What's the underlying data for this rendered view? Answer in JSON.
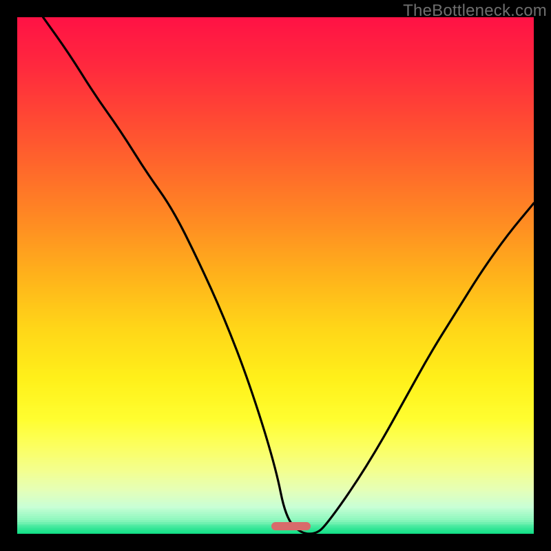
{
  "watermark": "TheBottleneck.com",
  "colors": {
    "frame": "#000000",
    "curve": "#000000",
    "marker": "#d86b6b",
    "watermark": "#6e6e6e"
  },
  "gradient_stops": [
    {
      "pos": 0.0,
      "color": "#ff1245"
    },
    {
      "pos": 0.1,
      "color": "#ff2b3d"
    },
    {
      "pos": 0.2,
      "color": "#ff4a33"
    },
    {
      "pos": 0.3,
      "color": "#ff6b2a"
    },
    {
      "pos": 0.4,
      "color": "#ff8d22"
    },
    {
      "pos": 0.5,
      "color": "#ffb21b"
    },
    {
      "pos": 0.6,
      "color": "#ffd518"
    },
    {
      "pos": 0.7,
      "color": "#fff01a"
    },
    {
      "pos": 0.78,
      "color": "#fffe30"
    },
    {
      "pos": 0.83,
      "color": "#fcff5e"
    },
    {
      "pos": 0.88,
      "color": "#f3ff90"
    },
    {
      "pos": 0.92,
      "color": "#e3ffba"
    },
    {
      "pos": 0.95,
      "color": "#c8ffd6"
    },
    {
      "pos": 0.975,
      "color": "#8df7bd"
    },
    {
      "pos": 0.99,
      "color": "#3ee89b"
    },
    {
      "pos": 1.0,
      "color": "#16e088"
    }
  ],
  "marker": {
    "x_frac": 0.53,
    "width_frac": 0.075,
    "y_frac": 0.985
  },
  "chart_data": {
    "type": "line",
    "title": "",
    "xlabel": "",
    "ylabel": "",
    "xlim": [
      0,
      100
    ],
    "ylim": [
      0,
      100
    ],
    "series": [
      {
        "name": "bottleneck-curve",
        "x": [
          5,
          10,
          15,
          20,
          25,
          30,
          35,
          40,
          45,
          50,
          52,
          55,
          58,
          60,
          65,
          70,
          75,
          80,
          85,
          90,
          95,
          100
        ],
        "y": [
          100,
          93,
          85,
          78,
          70,
          63,
          53,
          42,
          29,
          13,
          3,
          0,
          0,
          2,
          9,
          17,
          26,
          35,
          43,
          51,
          58,
          64
        ]
      }
    ],
    "optimal_zone": {
      "x_start": 52,
      "x_end": 59,
      "y": 1
    },
    "note": "x and y are percentages of plot width/height; y is distance from bottom (0 = bottom/green, 100 = top/red). Values estimated from pixel positions of the rendered curve."
  }
}
